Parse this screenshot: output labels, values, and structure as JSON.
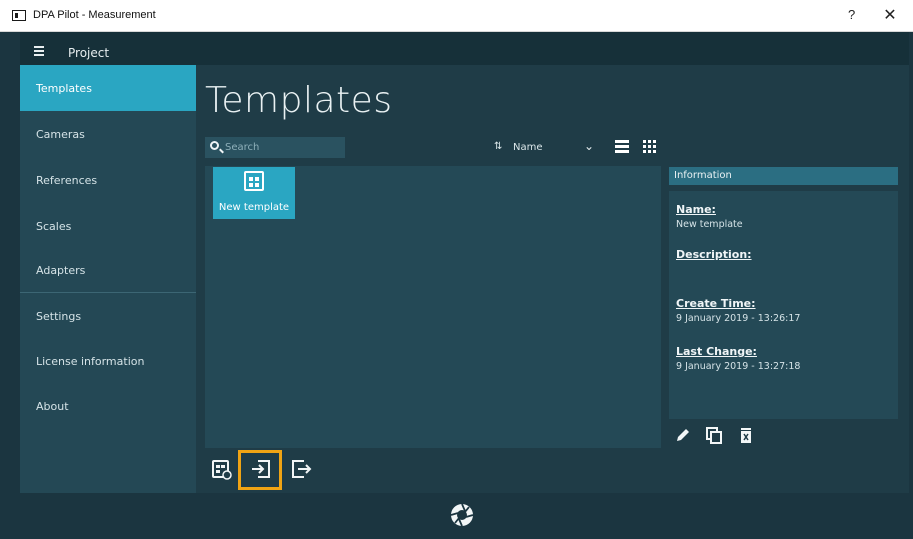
{
  "window": {
    "title": "DPA Pilot - Measurement",
    "help_label": "?",
    "close_label": "✕"
  },
  "project": {
    "label": "Project"
  },
  "sidebar": {
    "items": [
      {
        "label": "Templates",
        "active": true
      },
      {
        "label": "Cameras",
        "active": false
      },
      {
        "label": "References",
        "active": false
      },
      {
        "label": "Scales",
        "active": false
      },
      {
        "label": "Adapters",
        "active": false
      },
      {
        "label": "Settings",
        "active": false
      },
      {
        "label": "License information",
        "active": false
      },
      {
        "label": "About",
        "active": false
      }
    ]
  },
  "main": {
    "title": "Templates",
    "search": {
      "placeholder": "Search",
      "value": ""
    },
    "sort": {
      "label": "Name"
    },
    "templates": [
      {
        "name": "New template",
        "selected": true
      }
    ]
  },
  "info": {
    "header": "Information",
    "fields": [
      {
        "key": "Name:",
        "value": "New template"
      },
      {
        "key": "Description:",
        "value": ""
      },
      {
        "key": "Create Time:",
        "value": "9 January 2019 - 13:26:17"
      },
      {
        "key": "Last Change:",
        "value": "9 January 2019 - 13:27:18"
      }
    ]
  },
  "colors": {
    "accent": "#2aa6c2",
    "highlight": "#f0a414",
    "background": "#1f3c47"
  },
  "icons": {
    "sort": "sort-icon",
    "list_view": "list-view-icon",
    "grid_view": "grid-view-icon",
    "template": "template-icon",
    "new_template": "new-template-icon",
    "import": "import-icon",
    "export": "export-icon",
    "edit": "pencil-icon",
    "duplicate": "duplicate-icon",
    "delete": "trash-icon",
    "shutter": "shutter-icon"
  }
}
